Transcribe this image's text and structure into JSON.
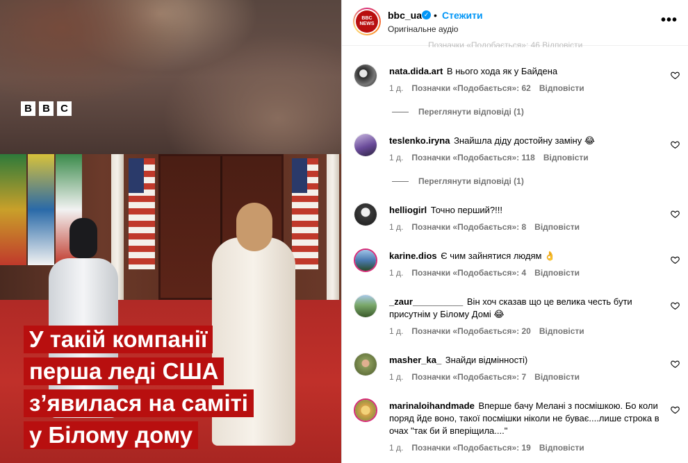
{
  "video": {
    "logo_letters": [
      "B",
      "B",
      "C"
    ],
    "caption_lines": [
      "У такій компанії",
      "перша леді США",
      "з’явилася на саміті",
      "у Білому дому"
    ]
  },
  "header": {
    "username": "bbc_ua",
    "verified": true,
    "dot": "•",
    "follow": "Стежити",
    "audio": "Оригінальне аудіо",
    "more": "•••",
    "avatar_text": [
      "BBC",
      "NEWS"
    ]
  },
  "comments": [
    {
      "user": "nata.dida.art",
      "text": "В нього хода як у Байдена",
      "age": "1 д.",
      "likes": "Позначки «Подобається»: 62",
      "reply": "Відповісти",
      "view_replies": "Переглянути відповіді (1)",
      "avatar_color": "#2b2b2b"
    },
    {
      "user": "teslenko.iryna",
      "text": "Знайшла діду достойну заміну 😂",
      "age": "1 д.",
      "likes": "Позначки «Подобається»: 118",
      "reply": "Відповісти",
      "view_replies": "Переглянути відповіді (1)",
      "avatar_color": "#6a4b9a"
    },
    {
      "user": "hellіogirl",
      "text": "Точно перший?!!!",
      "age": "1 д.",
      "likes": "Позначки «Подобається»: 8",
      "reply": "Відповісти",
      "avatar_color": "#3a3a3a"
    },
    {
      "user": "karine.dios",
      "text": "Є чим зайнятися людям 👌",
      "age": "1 д.",
      "likes": "Позначки «Подобається»: 4",
      "reply": "Відповісти",
      "avatar_color": "#4a7ab0"
    },
    {
      "user": "_zaur__________",
      "text": "Він хоч сказав що це велика честь бути присутнім у Білому Домі 😂",
      "age": "1 д.",
      "likes": "Позначки «Подобається»: 20",
      "reply": "Відповісти",
      "avatar_color": "#5a8a4a"
    },
    {
      "user": "masher_ka_",
      "text": "Знайди відмінності)",
      "age": "1 д.",
      "likes": "Позначки «Подобається»: 7",
      "reply": "Відповісти",
      "avatar_color": "#8a9a5a"
    },
    {
      "user": "marinaloihandmade",
      "text": "Вперше бачу Мелані з посмішкою. Бо коли поряд йде воно, такої посмішки ніколи не буває....лише строка в очах \"так би й вперіщила....\"",
      "age": "1 д.",
      "likes": "Позначки «Подобається»: 19",
      "reply": "Відповісти",
      "avatar_color": "#d8a24a"
    }
  ],
  "colors": {
    "accent": "#0095f6",
    "caption_bg": "#b80f0f",
    "meta": "#737373"
  },
  "icons": [
    "heart-icon",
    "verified-icon",
    "more-options-icon"
  ]
}
